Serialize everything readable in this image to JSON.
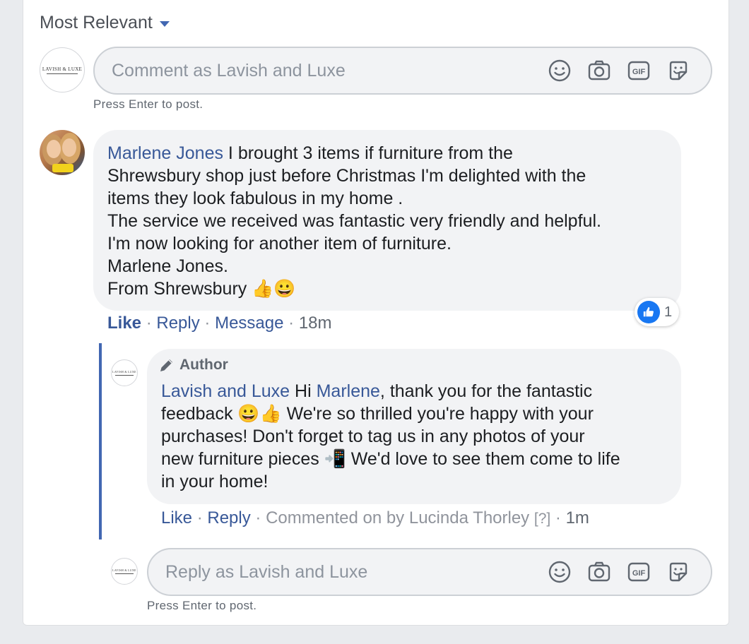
{
  "sort": {
    "label": "Most Relevant"
  },
  "composer": {
    "placeholder": "Comment as Lavish and Luxe",
    "hint": "Press Enter to post."
  },
  "page_avatar": {
    "text": "LAVISH & LUXE"
  },
  "comment": {
    "author": "Marlene Jones",
    "lines": [
      " I brought 3 items if furniture from the",
      "Shrewsbury shop just before Christmas I'm delighted with the",
      "items they look fabulous in my home .",
      "The service we received was fantastic very friendly and helpful.",
      "I'm now looking for another item of furniture.",
      "Marlene Jones.",
      "From Shrewsbury 👍😀"
    ],
    "actions": {
      "like": "Like",
      "reply": "Reply",
      "message": "Message",
      "time": "18m"
    },
    "reactions": {
      "count": "1"
    }
  },
  "reply": {
    "badge": "Author",
    "author": "Lavish and Luxe",
    "mention": "Marlene",
    "lines": {
      "l1_pre": " Hi ",
      "l1_post": ", thank you for the fantastic",
      "l2": "feedback 😀👍  We're so thrilled you're happy with your",
      "l3": "purchases! Don't forget to tag us in any photos of your",
      "l4": "new furniture pieces 📲  We'd love to see them come to life",
      "l5": "in your home!"
    },
    "actions": {
      "like": "Like",
      "reply": "Reply",
      "commented_by": "Commented on by Lucinda Thorley",
      "help": "[?]",
      "time": "1m"
    }
  },
  "reply_composer": {
    "placeholder": "Reply as Lavish and Luxe",
    "hint": "Press Enter to post."
  }
}
